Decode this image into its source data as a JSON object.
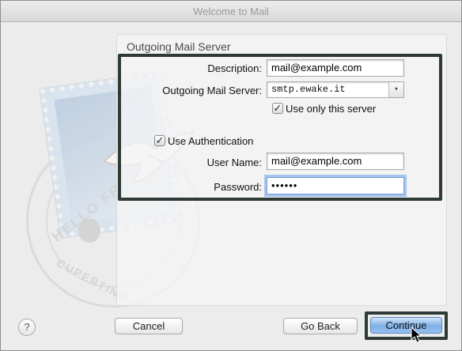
{
  "window": {
    "title": "Welcome to Mail"
  },
  "panel": {
    "title": "Outgoing Mail Server"
  },
  "form": {
    "description": {
      "label": "Description:",
      "value": "mail@example.com"
    },
    "outgoing_server": {
      "label": "Outgoing Mail Server:",
      "value": "smtp.ewake.it",
      "arrow": "▾"
    },
    "use_only_server": {
      "label": "Use only this server",
      "checked": true,
      "mark": "✓"
    },
    "use_authentication": {
      "label": "Use Authentication",
      "checked": true,
      "mark": "✓"
    },
    "user_name": {
      "label": "User Name:",
      "value": "mail@example.com"
    },
    "password": {
      "label": "Password:",
      "value": "••••••"
    }
  },
  "buttons": {
    "help": "?",
    "cancel": "Cancel",
    "go_back": "Go Back",
    "continue": "Continue"
  },
  "icons": {
    "help": "help-icon",
    "dropdown": "chevron-down-icon",
    "cursor": "pointer-cursor-icon",
    "stamp": "mail-stamp-icon"
  },
  "colors": {
    "accent": "#7fb0e6",
    "focus_ring": "#a6c5ec",
    "highlight_frame": "#2e3a36"
  }
}
